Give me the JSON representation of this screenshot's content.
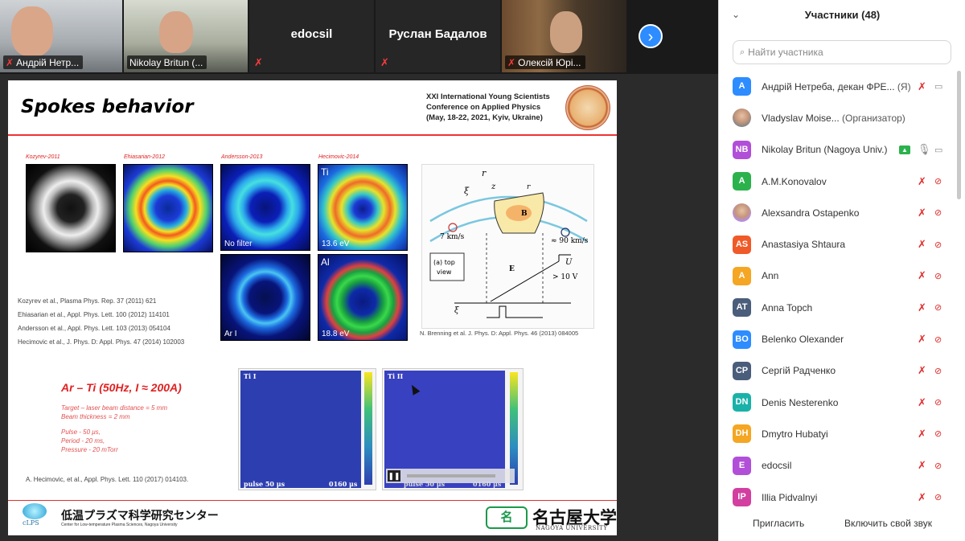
{
  "video_strip": {
    "tiles": [
      {
        "label": "Андрій Нетр..."
      },
      {
        "label": "Nikolay Britun (..."
      },
      {
        "name": "edocsil"
      },
      {
        "name": "Руслан Бадалов"
      },
      {
        "label": "Олексій Юрі..."
      }
    ]
  },
  "slide": {
    "title": "Spokes behavior",
    "conference": [
      "XXI International Young Scientists",
      "Conference on Applied Physics",
      "(May, 18-22, 2021, Kyiv, Ukraine)"
    ],
    "image_labels": [
      "Kozyrev-2011",
      "Ehiasarian-2012",
      "Andersson-2013",
      "Hecimovic-2014"
    ],
    "image_captions": {
      "no_filter": "No filter",
      "ar_i": "Ar I",
      "ti": "Ti",
      "ti_ev": "13.6 eV",
      "al": "Al",
      "al_ev": "18.8 eV"
    },
    "references": [
      "Kozyrev et al., Plasma Phys. Rep. 37 (2011) 621",
      "Ehiasarian et al., Appl. Phys. Lett. 100 (2012) 114101",
      "Andersson et al., Appl. Phys. Lett. 103 (2013) 054104",
      "Hecimovic et al., J. Phys. D: Appl. Phys. 47 (2014) 102003"
    ],
    "brenning_ref": "N. Brenning et al. J. Phys. D: Appl. Phys. 46 (2013) 084005",
    "diagram": {
      "r": "r",
      "z": "z",
      "xi": "ξ",
      "r1": "r",
      "B": "B",
      "left_speed": "7 km/s",
      "right_speed": "≈ 90 km/s",
      "view_label_1": "(a) top",
      "view_label_2": "view",
      "E": "E",
      "U": "U",
      "voltage": "> 10 V",
      "xi2": "ξ"
    },
    "arti_title": "Ar – Ti   (50Hz, I ≈ 200A)",
    "arti_details": [
      "Target – laser beam distance = 5 mm",
      "Beam thickness = 2 mm",
      "",
      "Pulse - 50 μs,",
      "Period - 20 ms,",
      "Pressure - 20 mTorr"
    ],
    "hecimovic_ref": "A. Hecimovic, et al., Appl. Phys. Lett. 110 (2017) 014103.",
    "plots": {
      "left_title": "Ti I",
      "left_pulse": "pulse 50 μs",
      "left_time": "0160 μs",
      "right_title": "Ti II",
      "right_pulse": "pulse 50 μs",
      "right_time": "0160 μs"
    },
    "clps": {
      "logo": "cLPS",
      "jp": "低温プラズマ科学研究センター",
      "en": "Center for Low-temperature Plasma Sciences, Nagoya University"
    },
    "nagoya": {
      "jp": "名古屋大学",
      "en": "NAGOYA UNIVERSITY"
    }
  },
  "participants_panel": {
    "title": "Участники (48)",
    "search_placeholder": "Найти участника",
    "participants": [
      {
        "initials": "A",
        "color": "#2d8cff",
        "name": "Андрій Нетреба, декан ФРЕ...",
        "ext": "(Я)",
        "mic": "muted",
        "cam": "on"
      },
      {
        "initials": "",
        "color": "#888888",
        "name": "Vladyslav Moise...",
        "ext": "(Организатор)",
        "mic": "none",
        "cam": "none"
      },
      {
        "initials": "NB",
        "color": "#b14fd8",
        "name": "Nikolay Britun (Nagoya Univ.)",
        "ext": "",
        "mic": "on",
        "cam": "on"
      },
      {
        "initials": "A",
        "color": "#2bb24c",
        "name": "A.M.Konovalov",
        "ext": "",
        "mic": "muted",
        "cam": "muted"
      },
      {
        "initials": "",
        "color": "#b58de0",
        "name": "Alexsandra Ostapenko",
        "ext": "",
        "mic": "muted",
        "cam": "muted"
      },
      {
        "initials": "AS",
        "color": "#f05a28",
        "name": "Anastasiya Shtaura",
        "ext": "",
        "mic": "muted",
        "cam": "muted"
      },
      {
        "initials": "A",
        "color": "#f5a623",
        "name": "Ann",
        "ext": "",
        "mic": "muted",
        "cam": "muted"
      },
      {
        "initials": "AT",
        "color": "#4a5d7a",
        "name": "Anna Topch",
        "ext": "",
        "mic": "muted",
        "cam": "muted"
      },
      {
        "initials": "BO",
        "color": "#2d8cff",
        "name": "Belenko Olexander",
        "ext": "",
        "mic": "muted",
        "cam": "muted"
      },
      {
        "initials": "CP",
        "color": "#4a5d7a",
        "name": "Сергій Радченко",
        "ext": "",
        "mic": "muted",
        "cam": "muted"
      },
      {
        "initials": "DN",
        "color": "#1ab2a8",
        "name": "Denis Nesterenko",
        "ext": "",
        "mic": "muted",
        "cam": "muted"
      },
      {
        "initials": "DH",
        "color": "#f5a623",
        "name": "Dmytro Hubatyi",
        "ext": "",
        "mic": "muted",
        "cam": "muted"
      },
      {
        "initials": "E",
        "color": "#b14fd8",
        "name": "edocsil",
        "ext": "",
        "mic": "muted",
        "cam": "muted"
      },
      {
        "initials": "IP",
        "color": "#d23fa0",
        "name": "Illia Pidvalnyi",
        "ext": "",
        "mic": "muted",
        "cam": "muted"
      }
    ],
    "invite_label": "Пригласить",
    "unmute_label": "Включить свой звук"
  }
}
